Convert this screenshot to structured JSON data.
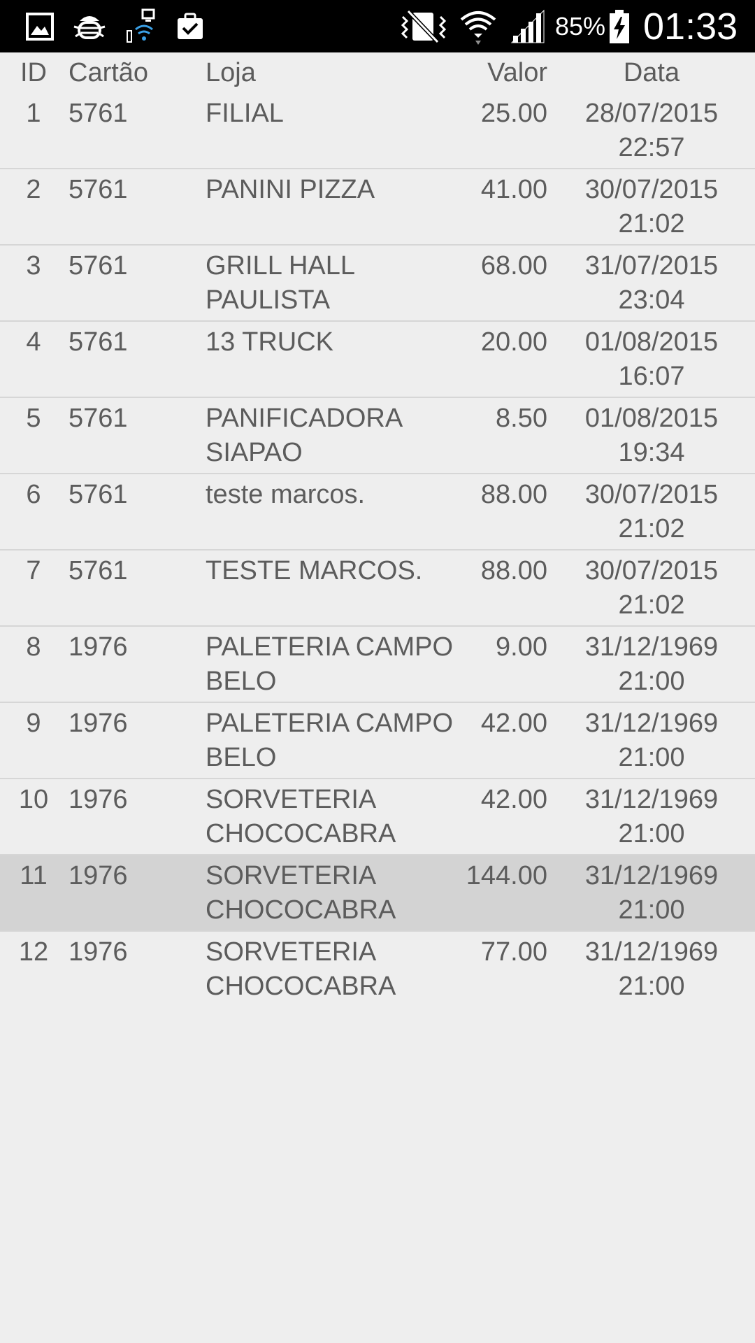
{
  "status_bar": {
    "battery_percent": "85%",
    "time": "01:33",
    "icons": [
      "gallery-icon",
      "debug-bug-icon",
      "computer-wifi-icon",
      "clipboard-check-icon",
      "vibrate-icon",
      "wifi-icon",
      "signal-icon",
      "battery-charging-icon"
    ]
  },
  "table": {
    "headers": {
      "id": "ID",
      "card": "Cartão",
      "store": "Loja",
      "value": "Valor",
      "date": "Data"
    },
    "rows": [
      {
        "id": "1",
        "card": "5761",
        "store": "FILIAL",
        "value": "25.00",
        "date": "28/07/2015",
        "time": "22:57"
      },
      {
        "id": "2",
        "card": "5761",
        "store": "PANINI PIZZA",
        "value": "41.00",
        "date": "30/07/2015",
        "time": "21:02"
      },
      {
        "id": "3",
        "card": "5761",
        "store": "GRILL HALL PAULISTA",
        "value": "68.00",
        "date": "31/07/2015",
        "time": "23:04"
      },
      {
        "id": "4",
        "card": "5761",
        "store": "13 TRUCK",
        "value": "20.00",
        "date": "01/08/2015",
        "time": "16:07"
      },
      {
        "id": "5",
        "card": "5761",
        "store": "PANIFICADORA SIAPAO",
        "value": "8.50",
        "date": "01/08/2015",
        "time": "19:34"
      },
      {
        "id": "6",
        "card": "5761",
        "store": "teste marcos.",
        "value": "88.00",
        "date": "30/07/2015",
        "time": "21:02"
      },
      {
        "id": "7",
        "card": "5761",
        "store": "TESTE MARCOS.",
        "value": "88.00",
        "date": "30/07/2015",
        "time": "21:02"
      },
      {
        "id": "8",
        "card": "1976",
        "store": "PALETERIA CAMPO BELO",
        "value": "9.00",
        "date": "31/12/1969",
        "time": "21:00"
      },
      {
        "id": "9",
        "card": "1976",
        "store": "PALETERIA CAMPO BELO",
        "value": "42.00",
        "date": "31/12/1969",
        "time": "21:00"
      },
      {
        "id": "10",
        "card": "1976",
        "store": "SORVETERIA CHOCOCABRA",
        "value": "42.00",
        "date": "31/12/1969",
        "time": "21:00"
      },
      {
        "id": "11",
        "card": "1976",
        "store": "SORVETERIA CHOCOCABRA",
        "value": "144.00",
        "date": "31/12/1969",
        "time": "21:00"
      },
      {
        "id": "12",
        "card": "1976",
        "store": "SORVETERIA CHOCOCABRA",
        "value": "77.00",
        "date": "31/12/1969",
        "time": "21:00"
      }
    ],
    "selected_row": "11"
  }
}
